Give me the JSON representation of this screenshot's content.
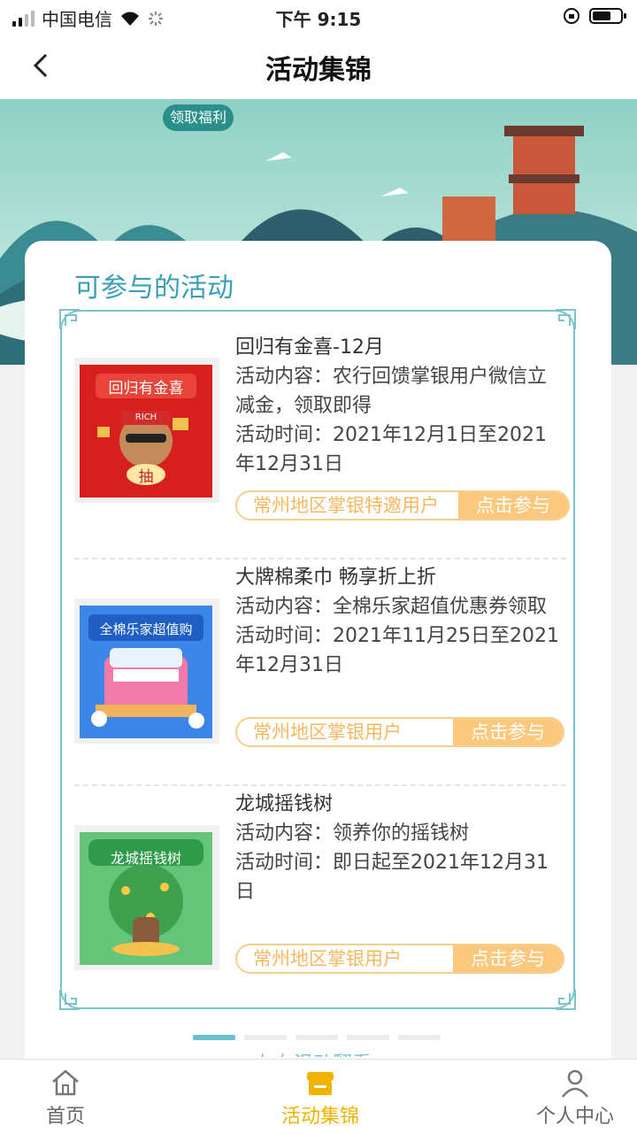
{
  "status_bar": {
    "carrier": "中国电信",
    "time": "下午 9:15"
  },
  "nav": {
    "title": "活动集锦"
  },
  "banner": {
    "pill_label": "领取福利"
  },
  "section": {
    "title": "可参与的活动"
  },
  "activities": [
    {
      "name": "回归有金喜-12月",
      "content": "活动内容：农行回馈掌银用户微信立减金，领取即得",
      "time": "活动时间：2021年12月1日至2021年12月31日",
      "tag": "常州地区掌银特邀用户",
      "button": "点击参与",
      "thumb_label": "回归有金喜",
      "thumb_sub": "抽",
      "thumb_badge": "RICH"
    },
    {
      "name": "大牌棉柔巾 畅享折上折",
      "content": "活动内容：全棉乐家超值优惠券领取",
      "time": "活动时间：2021年11月25日至2021年12月31日",
      "tag": "常州地区掌银用户",
      "button": "点击参与",
      "thumb_label": "全棉乐家超值购"
    },
    {
      "name": "龙城摇钱树",
      "content": "活动内容：领养你的摇钱树",
      "time": "活动时间：即日起至2021年12月31日",
      "tag": "常州地区掌银用户",
      "button": "点击参与",
      "thumb_label": "龙城摇钱树"
    }
  ],
  "peek_text": "左右滑动翻看",
  "pager": {
    "count": 5,
    "active": 1
  },
  "tabbar": [
    {
      "label": "首页",
      "icon": "home-icon"
    },
    {
      "label": "活动集锦",
      "icon": "shop-icon",
      "active": true
    },
    {
      "label": "个人中心",
      "icon": "person-icon"
    }
  ],
  "colors": {
    "accent": "#3a9fb6",
    "join_orange": "#fbc87e",
    "tab_active": "#f0b400"
  }
}
